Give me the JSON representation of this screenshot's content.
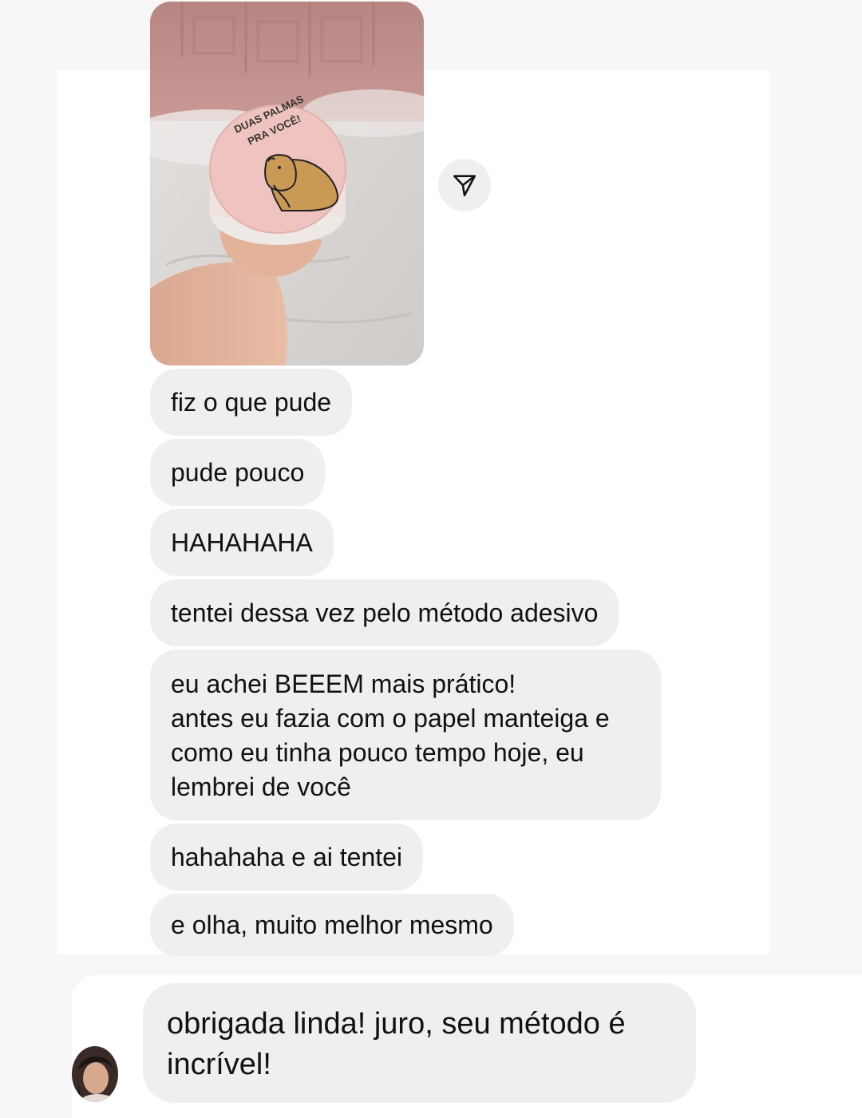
{
  "image_message": {
    "image_text_line1": "DUAS PALMAS",
    "image_text_line2": "PRA VOCÊ!",
    "share_icon": "paper-plane-icon"
  },
  "messages": [
    {
      "text": "fiz o que pude"
    },
    {
      "text": "pude pouco"
    },
    {
      "text": "HAHAHAHA"
    },
    {
      "text": "tentei dessa vez pelo método adesivo"
    },
    {
      "lines": [
        "eu achei BEEEM mais prático!",
        "antes eu fazia com o papel manteiga e",
        "como eu tinha pouco tempo hoje, eu",
        "lembrei de você"
      ]
    },
    {
      "text": "hahahaha e ai tentei"
    },
    {
      "text": "e olha, muito melhor mesmo"
    }
  ],
  "reply": {
    "lines": [
      "obrigada linda! juro, seu método é",
      "incrível!"
    ],
    "avatar_icon": "user-avatar"
  },
  "colors": {
    "bubble": "#efefef",
    "background": "#f7f7f8",
    "panel": "#ffffff",
    "cake_pink": "#f2c6c2",
    "capybara": "#c99a55"
  }
}
